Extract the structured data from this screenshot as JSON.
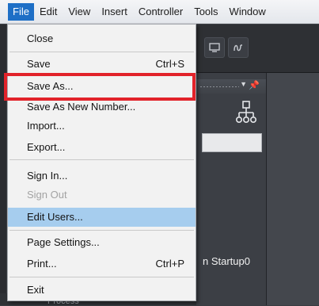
{
  "menubar": {
    "items": [
      {
        "label": "File"
      },
      {
        "label": "Edit"
      },
      {
        "label": "View"
      },
      {
        "label": "Insert"
      },
      {
        "label": "Controller"
      },
      {
        "label": "Tools"
      },
      {
        "label": "Window"
      }
    ]
  },
  "file_menu": {
    "close": "Close",
    "save": "Save",
    "save_shortcut": "Ctrl+S",
    "save_as": "Save As...",
    "save_as_new_number": "Save As New Number...",
    "import": "Import...",
    "export": "Export...",
    "sign_in": "Sign In...",
    "sign_out": "Sign Out",
    "edit_users": "Edit Users...",
    "page_settings": "Page Settings...",
    "print": "Print...",
    "print_shortcut": "Ctrl+P",
    "exit": "Exit"
  },
  "background": {
    "startup_label": "n Startup0",
    "bottom_text": "Process"
  },
  "colors": {
    "menu_highlight": "#a6cdee",
    "active_menu": "#1e6fc6",
    "annotation_box": "#e2232a"
  },
  "icons": [
    "toolbar-monitor-icon",
    "toolbar-symbol-icon",
    "hierarchy-icon",
    "pin-icon",
    "dropdown-arrow-icon"
  ]
}
